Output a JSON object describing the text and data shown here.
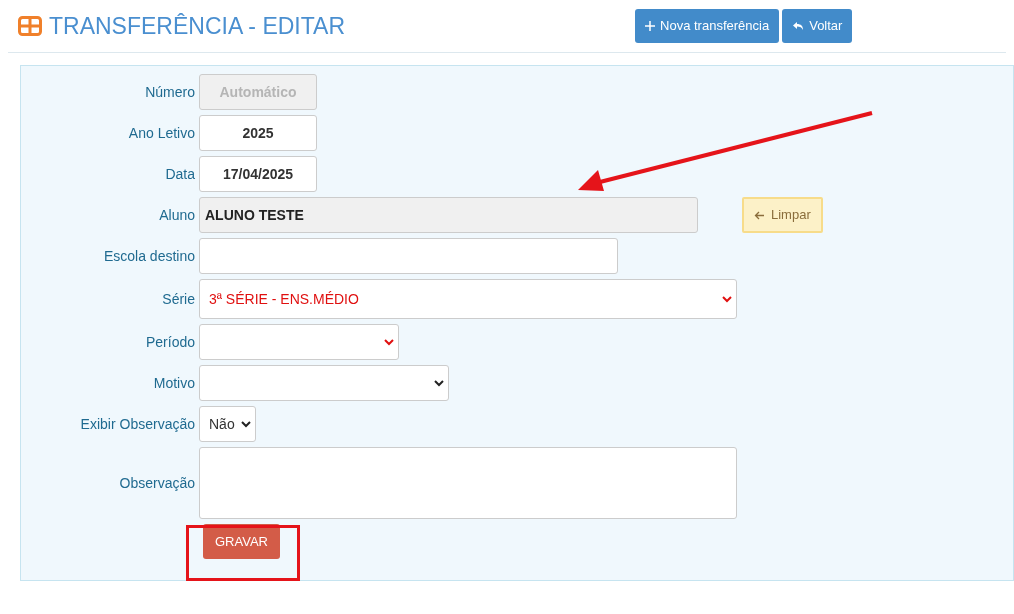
{
  "header": {
    "title": "TRANSFERÊNCIA - EDITAR",
    "buttons": [
      {
        "kind": "plus",
        "label": "Nova transferência"
      },
      {
        "kind": "back",
        "label": "Voltar"
      }
    ]
  },
  "form": {
    "fields": [
      {
        "kind": "readonly",
        "label": "Número",
        "placeholder": "Automático",
        "disabled": true
      },
      {
        "kind": "input",
        "label": "Ano Letivo",
        "value": "2025"
      },
      {
        "kind": "input",
        "label": "Data",
        "value": "17/04/2025"
      },
      {
        "kind": "readonly",
        "label": "Aluno",
        "value": "ALUNO TESTE",
        "disabled": false,
        "action": "Limpar"
      },
      {
        "kind": "input",
        "label": "Escola destino"
      },
      {
        "kind": "select",
        "label": "Série",
        "value": "3ª SÉRIE - ENS.MÉDIO",
        "required": true
      },
      {
        "kind": "select",
        "label": "Período",
        "required": true
      },
      {
        "kind": "select",
        "label": "Motivo",
        "required": false
      },
      {
        "kind": "select",
        "label": "Exibir Observação",
        "value": "Não",
        "required": false
      },
      {
        "kind": "textarea",
        "label": "Observação"
      }
    ],
    "submit": "GRAVAR"
  }
}
